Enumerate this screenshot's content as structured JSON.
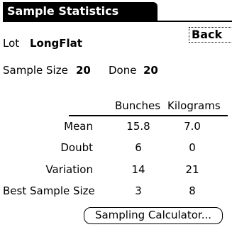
{
  "screen": {
    "title": "Sample Statistics",
    "back_label": "Back"
  },
  "lot": {
    "label": "Lot",
    "value": "LongFlat"
  },
  "sample": {
    "size_label": "Sample Size",
    "size_value": "20",
    "done_label": "Done",
    "done_value": "20"
  },
  "table": {
    "columns": [
      "Bunches",
      "Kilograms"
    ],
    "rows": [
      {
        "label": "Mean",
        "values": [
          "15.8",
          "7.0"
        ]
      },
      {
        "label": "Doubt",
        "values": [
          "6",
          "0"
        ]
      },
      {
        "label": "Variation",
        "values": [
          "14",
          "21"
        ]
      },
      {
        "label": "Best Sample Size",
        "values": [
          "3",
          "8"
        ]
      }
    ]
  },
  "calculator_button_label": "Sampling Calculator..."
}
